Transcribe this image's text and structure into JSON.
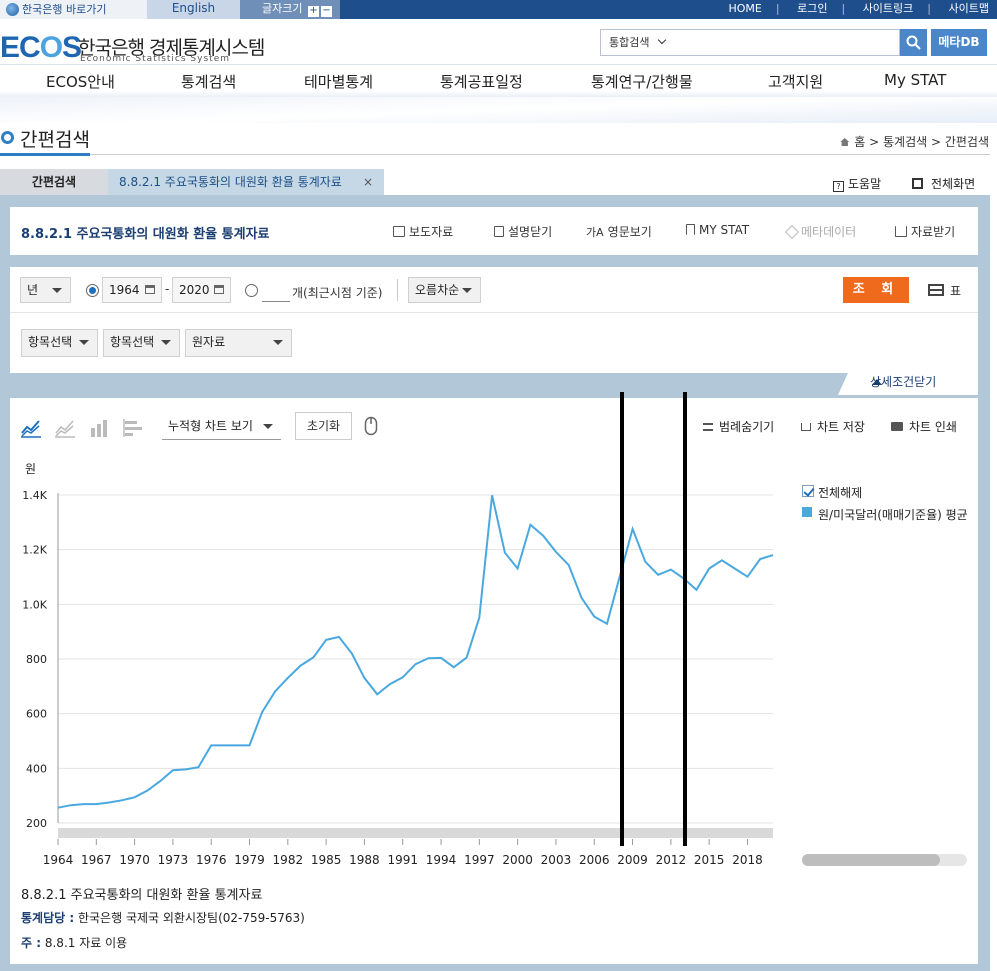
{
  "topbar": {
    "bok_link": "한국은행 바로가기",
    "english": "English",
    "font_size": "글자크기",
    "links": [
      "HOME",
      "로그인",
      "사이트링크",
      "사이트맵"
    ]
  },
  "header": {
    "logo_kr": "한국은행 경제통계시스템",
    "logo_en": "Economic Statistics System",
    "search_scope": "통합검색",
    "meta_button": "메타DB"
  },
  "nav": [
    "ECOS안내",
    "통계검색",
    "테마별통계",
    "통계공표일정",
    "통계연구/간행물",
    "고객지원",
    "My STAT"
  ],
  "page": {
    "title": "간편검색",
    "breadcrumb": "홈 > 통계검색 > 간편검색"
  },
  "tabs": {
    "tab1": "간편검색",
    "tab2": "8.8.2.1 주요국통화의 대원화 환율 통계자료",
    "close": "×",
    "help": "도움말",
    "fullscreen": "전체화면"
  },
  "toolbar": {
    "title": "8.8.2.1 주요국통화의 대원화 환율 통계자료",
    "press": "보도자료",
    "desc": "설명닫기",
    "english": "영문보기",
    "mystat": "MY STAT",
    "metadata": "메타데이터",
    "download": "자료받기"
  },
  "conditions": {
    "period": "년",
    "start_year": "1964",
    "end_year": "2020",
    "dash": "-",
    "count_label": "개(최근시점 기준)",
    "sort": "오름차순",
    "search_button": "조 회",
    "table_label": "표",
    "item1": "항목선택",
    "item2": "항목선택",
    "data_type": "원자료",
    "detail_close": "상세조건닫기"
  },
  "chart_tools": {
    "stack_view": "누적형 차트 보기",
    "reset": "초기화",
    "hide_legend": "범례숨기기",
    "save_chart": "차트 저장",
    "print_chart": "차트 인쇄"
  },
  "legend": {
    "toggle_all": "전체해제",
    "series": "원/미국달러(매매기준율) 평균"
  },
  "chart_data": {
    "type": "line",
    "ylabel": "원",
    "ylim": [
      200,
      1400
    ],
    "yticks": [
      "200",
      "400",
      "600",
      "800",
      "1.0K",
      "1.2K",
      "1.4K"
    ],
    "xticks": [
      "1964",
      "1967",
      "1970",
      "1973",
      "1976",
      "1979",
      "1982",
      "1985",
      "1988",
      "1991",
      "1994",
      "1997",
      "2000",
      "2003",
      "2006",
      "2009",
      "2012",
      "2015",
      "2018"
    ],
    "x": [
      1964,
      1965,
      1966,
      1967,
      1968,
      1969,
      1970,
      1971,
      1972,
      1973,
      1974,
      1975,
      1976,
      1977,
      1978,
      1979,
      1980,
      1981,
      1982,
      1983,
      1984,
      1985,
      1986,
      1987,
      1988,
      1989,
      1990,
      1991,
      1992,
      1993,
      1994,
      1995,
      1996,
      1997,
      1998,
      1999,
      2000,
      2001,
      2002,
      2003,
      2004,
      2005,
      2006,
      2007,
      2008,
      2009,
      2010,
      2011,
      2012,
      2013,
      2014,
      2015,
      2016,
      2017,
      2018,
      2019,
      2020
    ],
    "series": [
      {
        "name": "원/미국달러(매매기준율) 평균",
        "color": "#4aa8e0",
        "values": [
          256,
          265,
          269,
          269,
          275,
          283,
          294,
          319,
          353,
          393,
          396,
          404,
          484,
          484,
          484,
          484,
          607,
          681,
          731,
          776,
          806,
          870,
          881,
          821,
          731,
          671,
          708,
          733,
          781,
          803,
          804,
          770,
          805,
          951,
          1399,
          1189,
          1131,
          1291,
          1251,
          1192,
          1144,
          1024,
          955,
          929,
          1103,
          1276,
          1156,
          1108,
          1127,
          1095,
          1053,
          1131,
          1161,
          1131,
          1101,
          1166,
          1180
        ]
      }
    ],
    "grid": true,
    "legend": "right"
  },
  "footer": {
    "title": "8.8.2.1 주요국통화의 대원화 환율 통계자료",
    "contact_label": "통계담당 :",
    "contact": "한국은행 국제국 외환시장팀(02-759-5763)",
    "note_label": "주 :",
    "note": "8.8.1 자료 이용"
  }
}
